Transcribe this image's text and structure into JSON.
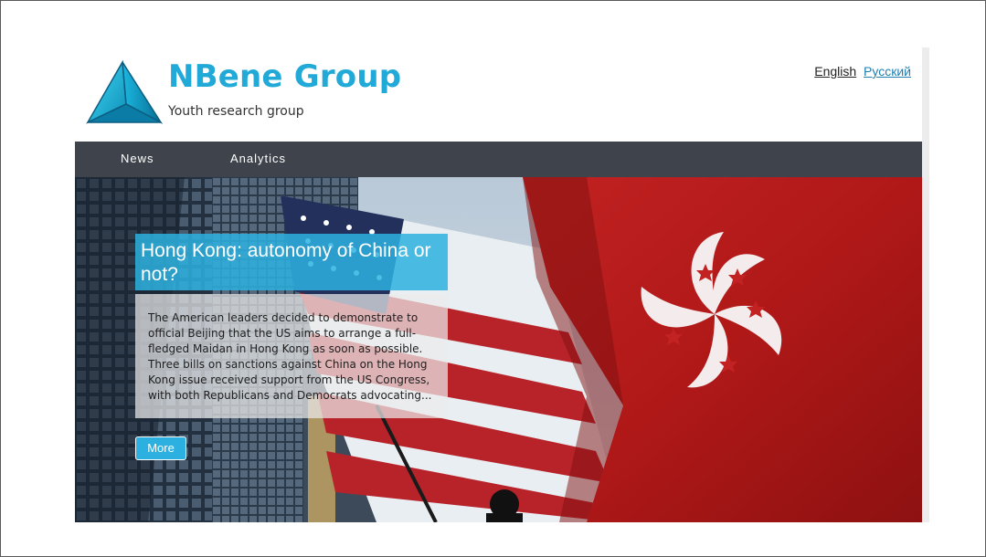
{
  "header": {
    "brand_name": "NBene Group",
    "tagline": "Youth research group",
    "logo_icon": "pyramid-logo-icon"
  },
  "language": {
    "current": "English",
    "alternate": "Русский"
  },
  "nav": {
    "items": [
      {
        "label": "News"
      },
      {
        "label": "Analytics"
      }
    ]
  },
  "hero": {
    "image_subject": "hong-kong-and-us-flags-image",
    "headline": "Hong Kong: autonomy of China or not?",
    "excerpt": "The American leaders decided to demonstrate to official Beijing that the US aims to arrange a full-fledged Maidan in Hong Kong as soon as possible. Three bills on sanctions against China on the Hong Kong issue received support from the US Congress, with both Republicans and Democrats advocating...",
    "more_label": "More"
  },
  "colors": {
    "brand": "#21a9d8",
    "nav_bg": "#3f444c",
    "headline_bg": "#2db2e0",
    "button_bg": "#2cb0e0"
  }
}
